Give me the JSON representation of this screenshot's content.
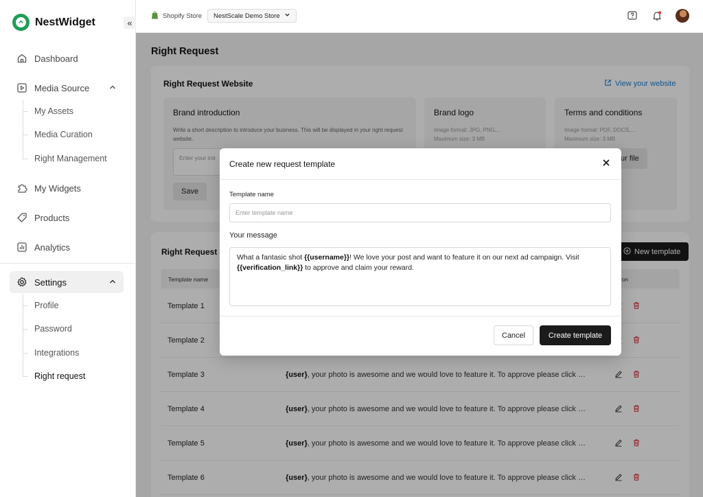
{
  "app": {
    "name": "NestWidget",
    "collapse_glyph": "«"
  },
  "sidebar": {
    "items": [
      {
        "label": "Dashboard",
        "icon": "home-icon"
      },
      {
        "label": "Media Source",
        "icon": "media-icon"
      },
      {
        "label": "My Widgets",
        "icon": "puzzle-icon"
      },
      {
        "label": "Products",
        "icon": "tag-icon"
      },
      {
        "label": "Analytics",
        "icon": "chart-icon"
      },
      {
        "label": "Settings",
        "icon": "gear-icon"
      }
    ],
    "media_sub": [
      "My Assets",
      "Media Curation",
      "Right Management"
    ],
    "settings_sub": [
      "Profile",
      "Password",
      "Integrations",
      "Right request"
    ]
  },
  "topbar": {
    "store_label": "Shopify Store",
    "store_value": "NestScale Demo Store"
  },
  "page": {
    "title": "Right Request",
    "website_card": {
      "title": "Right Request Website",
      "view_link": "View your website",
      "brand_intro": {
        "title": "Brand introduction",
        "desc": "Write a short description to introduce your business. This will be displayed in your right request website.",
        "placeholder": "Enter your intr",
        "save": "Save"
      },
      "brand_logo": {
        "title": "Brand logo",
        "format": "Image format: JPG, PNG,...",
        "size": "Maximum size: 3 MB"
      },
      "terms": {
        "title": "Terms and conditions",
        "format": "Image format: PDF, DOCS,...",
        "size": "Maximum size: 3 MB",
        "upload": "ur file"
      }
    },
    "templates_card": {
      "title": "Right Request M",
      "new_button": "New template",
      "columns": [
        "Template name",
        "ction"
      ],
      "rows": [
        {
          "name": "Template 1",
          "msg_var": "",
          "msg": ""
        },
        {
          "name": "Template 2",
          "msg_var": "",
          "msg": ""
        },
        {
          "name": "Template 3",
          "msg_var": "{user}",
          "msg": ", your photo is awesome and we would love to feature it. To approve please click o..."
        },
        {
          "name": "Template 4",
          "msg_var": "{user}",
          "msg": ", your photo is awesome and we would love to feature it. To approve please click o..."
        },
        {
          "name": "Template 5",
          "msg_var": "{user}",
          "msg": ", your photo is awesome and we would love to feature it. To approve please click o..."
        },
        {
          "name": "Template 6",
          "msg_var": "{user}",
          "msg": ", your photo is awesome and we would love to feature it. To approve please click o..."
        }
      ]
    }
  },
  "modal": {
    "title": "Create new request template",
    "name_label": "Template name",
    "name_placeholder": "Enter template name",
    "message_label": "Your message",
    "message": {
      "p1": "What a fantasic shot ",
      "v1": "{{username}}",
      "p2": "! We love your post and want to feature it on our next ad campaign. Visit ",
      "v2": "{{verification_link}}",
      "p3": " to approve and claim your reward."
    },
    "cancel": "Cancel",
    "create": "Create template"
  },
  "colors": {
    "brand": "#1f9d55",
    "link": "#1a7fd6",
    "delete": "#e0393e",
    "dark_button": "#1b1b1b"
  }
}
